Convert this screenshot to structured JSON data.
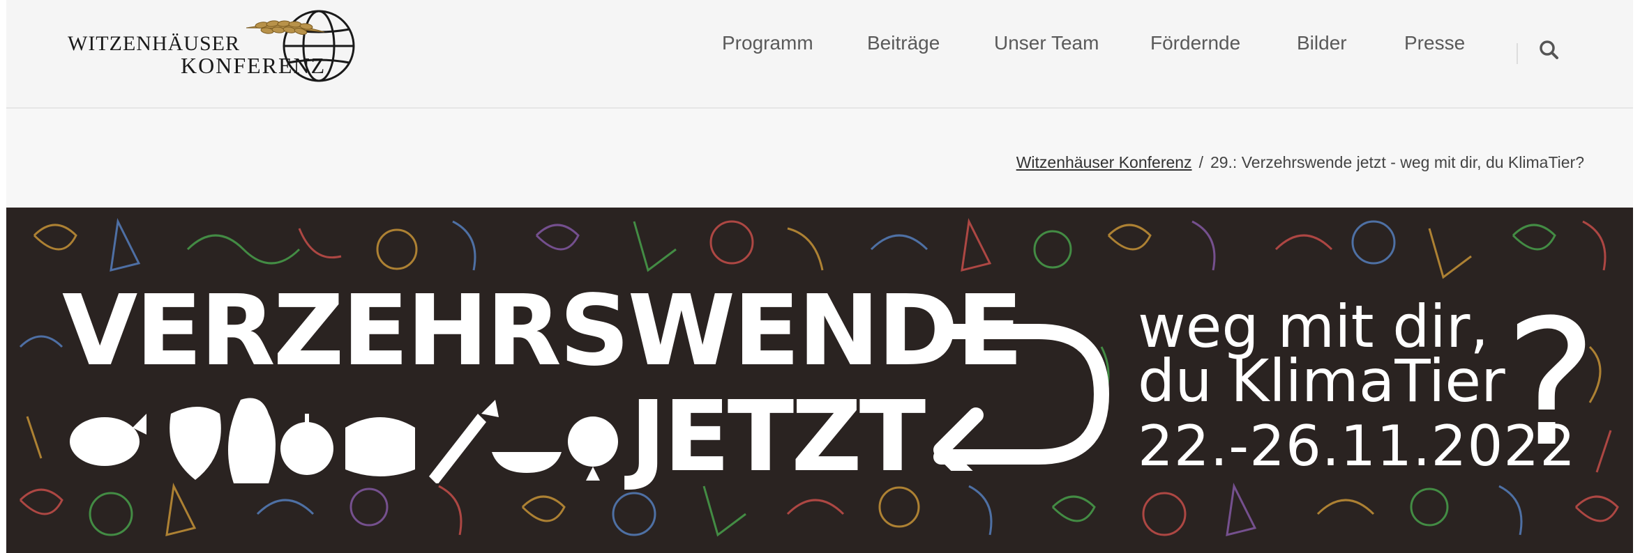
{
  "logo": {
    "line1": "WITZENHÄUSER",
    "line2": "KONFERENZ"
  },
  "nav": {
    "items": [
      "Programm",
      "Beiträge",
      "Unser Team",
      "Fördernde",
      "Bilder",
      "Presse"
    ],
    "search_icon": "search-icon"
  },
  "breadcrumb": {
    "home": "Witzenhäuser Konferenz",
    "separator": "/",
    "current": "29.: Verzehrswende jetzt - weg mit dir, du KlimaTier?"
  },
  "banner": {
    "headline_line1": "VERZEHRSWENDE",
    "headline_line2": "JETZT",
    "tagline_line1": "weg mit dir,",
    "tagline_line2": "du KlimaTier",
    "dates": "22.-26.11.2022",
    "question_mark": "?",
    "background_color": "#2a2321",
    "icons": [
      "pig-icon",
      "pepper-icon",
      "chicken-icon",
      "apple-icon",
      "cow-icon",
      "carrot-icon",
      "grain-bowl-icon",
      "radish-icon"
    ]
  }
}
